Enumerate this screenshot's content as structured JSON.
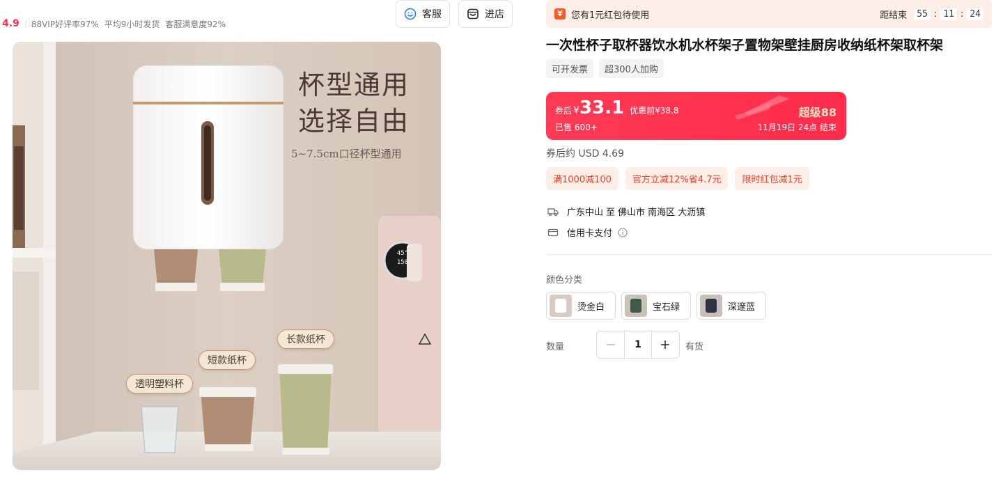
{
  "store": {
    "rating": "4.9",
    "stats": [
      "88VIP好评率97%",
      "平均9小时发货",
      "客服满意度92%"
    ],
    "service_label": "客服",
    "store_label": "进店"
  },
  "hero": {
    "headline_line1": "杯型通用",
    "headline_line2": "选择自由",
    "subline": "5~7.5cm口径杯型通用",
    "tag_long": "长款纸杯",
    "tag_short": "短款纸杯",
    "tag_plastic": "透明塑料杯",
    "display_line1": "45°",
    "display_line2": "150"
  },
  "coupon_bar": {
    "badge": "¥",
    "text": "您有1元红包待使用",
    "countdown_label": "距结束",
    "hours": "55",
    "minutes": "11",
    "seconds": "24"
  },
  "product": {
    "title": "一次性杯子取杯器饮水机水杯架子置物架壁挂厨房收纳纸杯架取杯架",
    "tags": [
      "可开发票",
      "超300人加购"
    ]
  },
  "price_card": {
    "label": "券后",
    "currency": "¥",
    "price": "33.1",
    "original": "优惠前¥38.8",
    "sold": "已售 600+",
    "badge": "超级88",
    "end_time": "11月19日 24点 结束"
  },
  "usd_price": "券后约 USD 4.69",
  "promotions": [
    "满1000减100",
    "官方立减12%省4.7元",
    "限时红包减1元"
  ],
  "shipping": {
    "from": "广东中山",
    "connector": "至",
    "to": "佛山市 南海区 大沥镇"
  },
  "payment": {
    "text": "信用卡支付"
  },
  "color_section": {
    "label": "颜色分类",
    "options": [
      "烫金白",
      "宝石绿",
      "深邃蓝"
    ]
  },
  "quantity": {
    "label": "数量",
    "value": "1",
    "stock": "有货"
  }
}
